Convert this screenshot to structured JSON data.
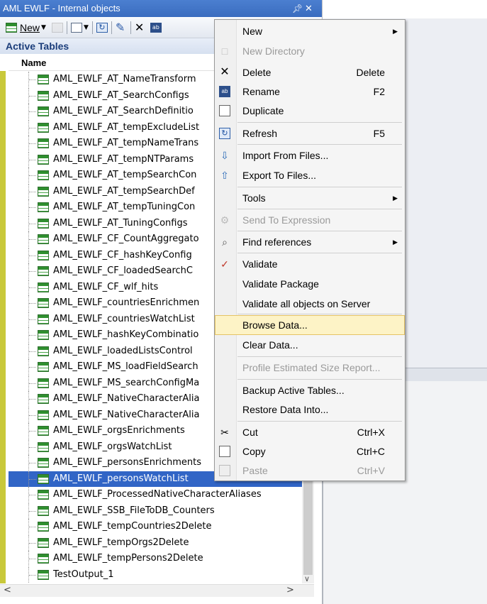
{
  "window": {
    "title": "AML EWLF - Internal objects",
    "pin_icon": "pin-icon",
    "close_icon": "close-icon"
  },
  "toolbar": {
    "new_label": "New"
  },
  "section_title": "Active Tables",
  "column_header": "Name",
  "rows": [
    "AML_EWLF_AT_NameTransform",
    "AML_EWLF_AT_SearchConfigs",
    "AML_EWLF_AT_SearchDefinitio",
    "AML_EWLF_AT_tempExcludeList",
    "AML_EWLF_AT_tempNameTrans",
    "AML_EWLF_AT_tempNTParams",
    "AML_EWLF_AT_tempSearchCon",
    "AML_EWLF_AT_tempSearchDef",
    "AML_EWLF_AT_tempTuningCon",
    "AML_EWLF_AT_TuningConfigs",
    "AML_EWLF_CF_CountAggregato",
    "AML_EWLF_CF_hashKeyConfig",
    "AML_EWLF_CF_loadedSearchC",
    "AML_EWLF_CF_wlf_hits",
    "AML_EWLF_countriesEnrichmen",
    "AML_EWLF_countriesWatchList",
    "AML_EWLF_hashKeyCombinatio",
    "AML_EWLF_loadedListsControl",
    "AML_EWLF_MS_loadFieldSearch",
    "AML_EWLF_MS_searchConfigMa",
    "AML_EWLF_NativeCharacterAlia",
    "AML_EWLF_NativeCharacterAlia",
    "AML_EWLF_orgsEnrichments",
    "AML_EWLF_orgsWatchList",
    "AML_EWLF_personsEnrichments",
    "AML_EWLF_personsWatchList",
    "AML_EWLF_ProcessedNativeCharacterAliases",
    "AML_EWLF_SSB_FileToDB_Counters",
    "AML_EWLF_tempCountries2Delete",
    "AML_EWLF_tempOrgs2Delete",
    "AML_EWLF_tempPersons2Delete",
    "TestOutput_1"
  ],
  "selected_row": "AML_EWLF_personsWatchList",
  "menu": {
    "new": "New",
    "new_directory": "New Directory",
    "delete": "Delete",
    "delete_sc": "Delete",
    "rename": "Rename",
    "rename_sc": "F2",
    "duplicate": "Duplicate",
    "refresh": "Refresh",
    "refresh_sc": "F5",
    "import_from_files": "Import From Files...",
    "export_to_files": "Export To Files...",
    "tools": "Tools",
    "send_to_expression": "Send To Expression",
    "find_references": "Find references",
    "validate": "Validate",
    "validate_package": "Validate Package",
    "validate_all": "Validate all objects on Server",
    "browse_data": "Browse Data...",
    "clear_data": "Clear Data...",
    "profile_size": "Profile Estimated Size Report...",
    "backup": "Backup Active Tables...",
    "restore": "Restore Data Into...",
    "cut": "Cut",
    "cut_sc": "Ctrl+X",
    "copy": "Copy",
    "copy_sc": "Ctrl+C",
    "paste": "Paste",
    "paste_sc": "Ctrl+V"
  },
  "colors": {
    "selection": "#3165c6",
    "title_bar": "#3a6cbf",
    "menu_highlight": "#fdf3c6"
  }
}
